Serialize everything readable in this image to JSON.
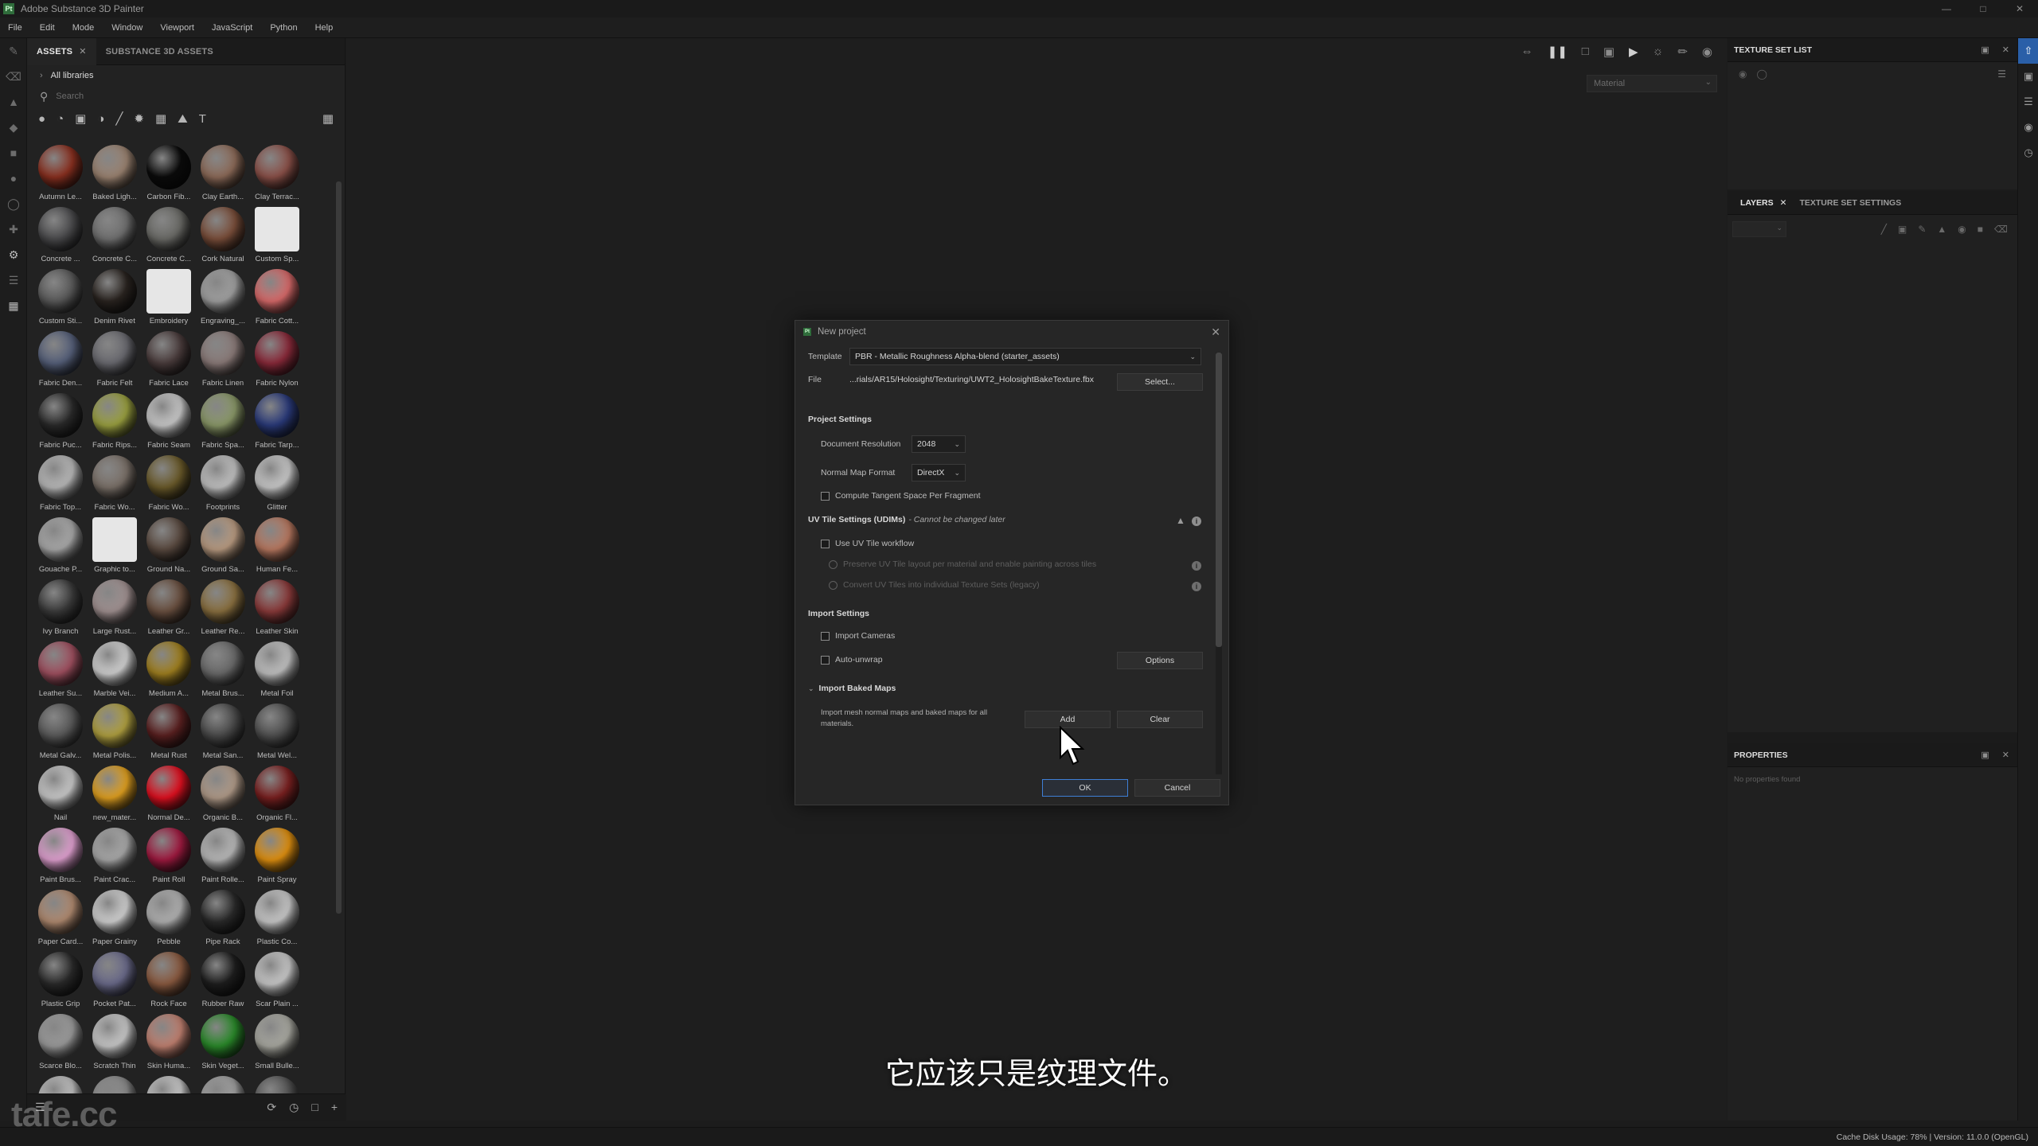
{
  "window": {
    "title": "Adobe Substance 3D Painter",
    "logo": "Pt"
  },
  "menu": [
    "File",
    "Edit",
    "Mode",
    "Window",
    "Viewport",
    "JavaScript",
    "Python",
    "Help"
  ],
  "assets_panel": {
    "tab_assets": "ASSETS",
    "tab_substance": "SUBSTANCE 3D ASSETS",
    "all_libraries": "All libraries",
    "search_placeholder": "Search",
    "items": [
      {
        "label": "Autumn Le...",
        "color": "#8a3020"
      },
      {
        "label": "Baked Ligh...",
        "color": "#9a8270"
      },
      {
        "label": "Carbon Fib...",
        "color": "#0b0b0b"
      },
      {
        "label": "Clay Earth...",
        "color": "#8c6a58"
      },
      {
        "label": "Clay Terrac...",
        "color": "#8a5048"
      },
      {
        "label": "Concrete ...",
        "color": "#4a4a4c"
      },
      {
        "label": "Concrete C...",
        "color": "#707070"
      },
      {
        "label": "Concrete C...",
        "color": "#6a6a66"
      },
      {
        "label": "Cork Natural",
        "color": "#7a4e3a"
      },
      {
        "label": "Custom Sp...",
        "color": "#e8e8e8"
      },
      {
        "label": "Custom Sti...",
        "color": "#5a5a5a"
      },
      {
        "label": "Denim Rivet",
        "color": "#2a2420"
      },
      {
        "label": "Embroidery",
        "color": "#e0e0e0"
      },
      {
        "label": "Engraving_...",
        "color": "#a0a0a0"
      },
      {
        "label": "Fabric Cott...",
        "color": "#d86a6a"
      },
      {
        "label": "Fabric Den...",
        "color": "#56607a"
      },
      {
        "label": "Fabric Felt",
        "color": "#6a6a70"
      },
      {
        "label": "Fabric Lace",
        "color": "#4a3c3c"
      },
      {
        "label": "Fabric Linen",
        "color": "#8a7a78"
      },
      {
        "label": "Fabric Nylon",
        "color": "#8a2a3a"
      },
      {
        "label": "Fabric Puc...",
        "color": "#2a2a2a"
      },
      {
        "label": "Fabric Rips...",
        "color": "#9aa040"
      },
      {
        "label": "Fabric Seam",
        "color": "#c8c8c8"
      },
      {
        "label": "Fabric Spa...",
        "color": "#8a9868"
      },
      {
        "label": "Fabric Tarp...",
        "color": "#2a3a7a"
      },
      {
        "label": "Fabric Top...",
        "color": "#b8b8b8"
      },
      {
        "label": "Fabric Wo...",
        "color": "#7a7068"
      },
      {
        "label": "Fabric Wo...",
        "color": "#6a5a2a"
      },
      {
        "label": "Footprints",
        "color": "#c0c0c0"
      },
      {
        "label": "Glitter",
        "color": "#c8c8c8"
      },
      {
        "label": "Gouache P...",
        "color": "#a8a8a8"
      },
      {
        "label": "Graphic to...",
        "color": "#e6e6e6"
      },
      {
        "label": "Ground Na...",
        "color": "#5a4a40"
      },
      {
        "label": "Ground Sa...",
        "color": "#b89a80"
      },
      {
        "label": "Human Fe...",
        "color": "#b87860"
      },
      {
        "label": "Ivy Branch",
        "color": "#3a3a3a"
      },
      {
        "label": "Large Rust...",
        "color": "#a09090"
      },
      {
        "label": "Leather Gr...",
        "color": "#6a5040"
      },
      {
        "label": "Leather Re...",
        "color": "#8a7040"
      },
      {
        "label": "Leather Skin",
        "color": "#8a3a3a"
      },
      {
        "label": "Leather Su...",
        "color": "#a05060"
      },
      {
        "label": "Marble Vei...",
        "color": "#d0d0d0"
      },
      {
        "label": "Medium A...",
        "color": "#a08020"
      },
      {
        "label": "Metal Brus...",
        "color": "#6a6a6a"
      },
      {
        "label": "Metal Foil",
        "color": "#c0c0c0"
      },
      {
        "label": "Metal Galv...",
        "color": "#5a5a5a"
      },
      {
        "label": "Metal Polis...",
        "color": "#b0a040"
      },
      {
        "label": "Metal Rust",
        "color": "#5a2020"
      },
      {
        "label": "Metal San...",
        "color": "#4a4a4a"
      },
      {
        "label": "Metal Wel...",
        "color": "#505050"
      },
      {
        "label": "Nail",
        "color": "#c8c8c8"
      },
      {
        "label": "new_mater...",
        "color": "#e0a020"
      },
      {
        "label": "Normal De...",
        "color": "#e01020"
      },
      {
        "label": "Organic B...",
        "color": "#b09a88"
      },
      {
        "label": "Organic Fl...",
        "color": "#7a2020"
      },
      {
        "label": "Paint Brus...",
        "color": "#e0a0d0"
      },
      {
        "label": "Paint Crac...",
        "color": "#a8a8a8"
      },
      {
        "label": "Paint Roll",
        "color": "#a01a40"
      },
      {
        "label": "Paint Rolle...",
        "color": "#b8b8b8"
      },
      {
        "label": "Paint Spray",
        "color": "#e09010"
      },
      {
        "label": "Paper Card...",
        "color": "#b08a70"
      },
      {
        "label": "Paper Grainy",
        "color": "#d0d0d0"
      },
      {
        "label": "Pebble",
        "color": "#b0b0b0"
      },
      {
        "label": "Pipe Rack",
        "color": "#2a2a2a"
      },
      {
        "label": "Plastic Co...",
        "color": "#c8c8c8"
      },
      {
        "label": "Plastic Grip",
        "color": "#2a2a2a"
      },
      {
        "label": "Pocket Pat...",
        "color": "#6a6a8a"
      },
      {
        "label": "Rock Face",
        "color": "#8a5a40"
      },
      {
        "label": "Rubber Raw",
        "color": "#1e1e1e"
      },
      {
        "label": "Scar Plain ...",
        "color": "#c8c8c8"
      },
      {
        "label": "Scarce Blo...",
        "color": "#9a9a9a"
      },
      {
        "label": "Scratch Thin",
        "color": "#c8c8c8"
      },
      {
        "label": "Skin Huma...",
        "color": "#c08070"
      },
      {
        "label": "Skin Veget...",
        "color": "#2a8a2a"
      },
      {
        "label": "Small Bulle...",
        "color": "#a8a8a0"
      },
      {
        "label": "",
        "color": "#c0c0c0"
      },
      {
        "label": "",
        "color": "#8a8a8a"
      },
      {
        "label": "",
        "color": "#c8c8c8"
      },
      {
        "label": "",
        "color": "#a0a0a0"
      },
      {
        "label": "",
        "color": "#555555"
      }
    ]
  },
  "watermark": "tafe.cc",
  "viewport": {
    "material_select": "Material",
    "subtitle": "它应该只是纹理文件。"
  },
  "dialog": {
    "title": "New project",
    "template_label": "Template",
    "template_value": "PBR - Metallic Roughness Alpha-blend (starter_assets)",
    "file_label": "File",
    "file_value": "...rials/AR15/Holosight/Texturing/UWT2_HolosightBakeTexture.fbx",
    "select_button": "Select...",
    "project_settings": "Project Settings",
    "doc_res_label": "Document Resolution",
    "doc_res_value": "2048",
    "normal_format_label": "Normal Map Format",
    "normal_format_value": "DirectX",
    "tangent_label": "Compute Tangent Space Per Fragment",
    "uv_tile_title": "UV Tile Settings (UDIMs)",
    "uv_tile_note": "- Cannot be changed later",
    "use_uv_tile": "Use UV Tile workflow",
    "preserve_uv": "Preserve UV Tile layout per material and enable painting across tiles",
    "convert_uv": "Convert UV Tiles into individual Texture Sets (legacy)",
    "import_settings": "Import Settings",
    "import_cameras": "Import Cameras",
    "auto_unwrap": "Auto-unwrap",
    "options_button": "Options",
    "import_baked": "Import Baked Maps",
    "baked_desc": "Import mesh normal maps and baked maps for all materials.",
    "add_button": "Add",
    "clear_button": "Clear",
    "ok_button": "OK",
    "cancel_button": "Cancel"
  },
  "right": {
    "texture_set_list": "TEXTURE SET LIST",
    "layers_tab": "LAYERS",
    "tss_tab": "TEXTURE SET SETTINGS",
    "properties": "PROPERTIES",
    "no_properties": "No properties found"
  },
  "status": {
    "text": "Cache Disk Usage:   78% | Version: 11.0.0 (OpenGL)"
  }
}
